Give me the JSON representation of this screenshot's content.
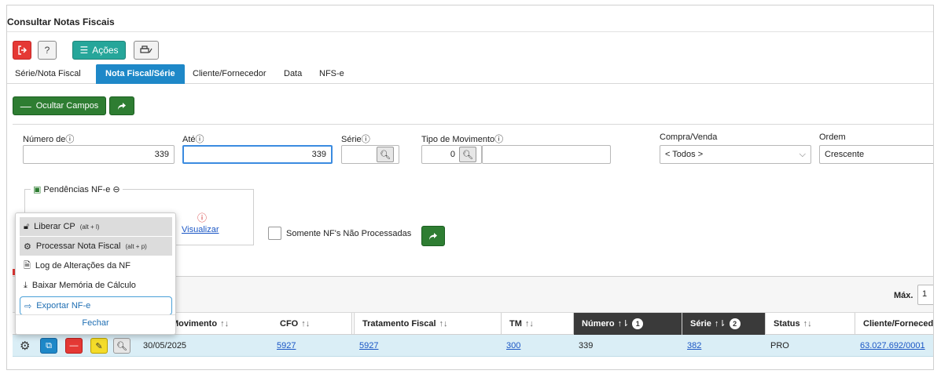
{
  "page": {
    "title": "Consultar Notas Fiscais"
  },
  "toolbar": {
    "exit_icon": "exit-icon",
    "help_label": "?",
    "acoes_label": "Ações",
    "print_icon": "printer-icon"
  },
  "tabs": [
    {
      "label": "Série/Nota Fiscal",
      "active": false
    },
    {
      "label": "Nota Fiscal/Série",
      "active": true
    },
    {
      "label": "Cliente/Fornecedor",
      "active": false
    },
    {
      "label": "Data",
      "active": false
    },
    {
      "label": "NFS-e",
      "active": false
    }
  ],
  "filters": {
    "hide_fields_label": "Ocultar Campos",
    "numero_de": {
      "label": "Número de",
      "value": "339"
    },
    "ate": {
      "label": "Até",
      "value": "339"
    },
    "serie": {
      "label": "Série",
      "value": ""
    },
    "tipo_movimento": {
      "label": "Tipo de Movimento",
      "value": "0",
      "desc": ""
    },
    "compra_venda": {
      "label": "Compra/Venda",
      "value": "< Todos >"
    },
    "ordem": {
      "label": "Ordem",
      "value": "Crescente"
    },
    "pendencias": {
      "legend": "Pendências NF-e",
      "link": "Visualizar"
    },
    "somente_label": "Somente NF's Não Processadas"
  },
  "grid": {
    "max_label": "Máx.",
    "max_value": "1",
    "columns": [
      {
        "label": "Movimento"
      },
      {
        "label": "CFO"
      },
      {
        "label": "Tratamento Fiscal"
      },
      {
        "label": "TM"
      },
      {
        "label": "Número",
        "badge": "1"
      },
      {
        "label": "Série",
        "badge": "2"
      },
      {
        "label": "Status"
      },
      {
        "label": "Cliente/Fornecedor"
      }
    ],
    "rows": [
      {
        "movimento": "30/05/2025",
        "cfo": "5927",
        "tratamento": "5927",
        "tm": "300",
        "numero": "339",
        "serie": "382",
        "status": "PRO",
        "cliente": "63.027.692/0001"
      }
    ]
  },
  "context_menu": {
    "items": [
      {
        "label": "Liberar CP",
        "shortcut": "(alt + l)"
      },
      {
        "label": "Processar Nota Fiscal",
        "shortcut": "(alt + p)"
      },
      {
        "label": "Log de Alterações da NF",
        "shortcut": ""
      },
      {
        "label": "Baixar Memória de Cálculo",
        "shortcut": ""
      },
      {
        "label": "Exportar NF-e",
        "shortcut": ""
      }
    ],
    "close_label": "Fechar"
  },
  "colors": {
    "primary": "#1e88c8",
    "success": "#2e7d32",
    "danger": "#e53935",
    "teal": "#26a69a",
    "row_highlight": "#daeef6",
    "header_dark": "#3a3a3a",
    "link": "#1a56c5"
  }
}
